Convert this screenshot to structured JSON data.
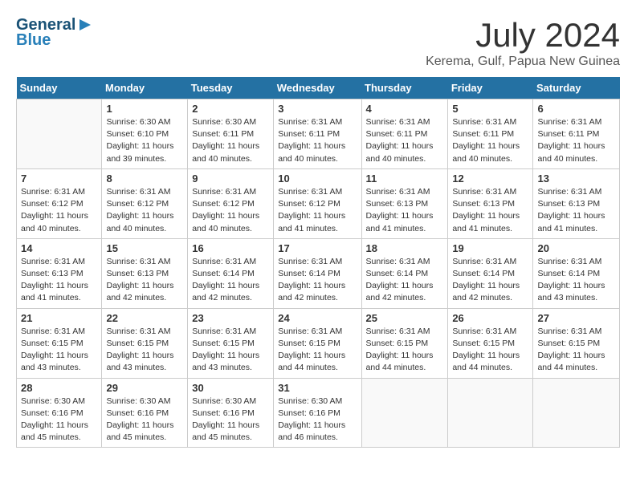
{
  "header": {
    "logo_general": "General",
    "logo_blue": "Blue",
    "title": "July 2024",
    "location": "Kerema, Gulf, Papua New Guinea"
  },
  "days_of_week": [
    "Sunday",
    "Monday",
    "Tuesday",
    "Wednesday",
    "Thursday",
    "Friday",
    "Saturday"
  ],
  "weeks": [
    [
      {
        "day": "",
        "info": ""
      },
      {
        "day": "1",
        "info": "Sunrise: 6:30 AM\nSunset: 6:10 PM\nDaylight: 11 hours\nand 39 minutes."
      },
      {
        "day": "2",
        "info": "Sunrise: 6:30 AM\nSunset: 6:11 PM\nDaylight: 11 hours\nand 40 minutes."
      },
      {
        "day": "3",
        "info": "Sunrise: 6:31 AM\nSunset: 6:11 PM\nDaylight: 11 hours\nand 40 minutes."
      },
      {
        "day": "4",
        "info": "Sunrise: 6:31 AM\nSunset: 6:11 PM\nDaylight: 11 hours\nand 40 minutes."
      },
      {
        "day": "5",
        "info": "Sunrise: 6:31 AM\nSunset: 6:11 PM\nDaylight: 11 hours\nand 40 minutes."
      },
      {
        "day": "6",
        "info": "Sunrise: 6:31 AM\nSunset: 6:11 PM\nDaylight: 11 hours\nand 40 minutes."
      }
    ],
    [
      {
        "day": "7",
        "info": "Sunrise: 6:31 AM\nSunset: 6:12 PM\nDaylight: 11 hours\nand 40 minutes."
      },
      {
        "day": "8",
        "info": "Sunrise: 6:31 AM\nSunset: 6:12 PM\nDaylight: 11 hours\nand 40 minutes."
      },
      {
        "day": "9",
        "info": "Sunrise: 6:31 AM\nSunset: 6:12 PM\nDaylight: 11 hours\nand 40 minutes."
      },
      {
        "day": "10",
        "info": "Sunrise: 6:31 AM\nSunset: 6:12 PM\nDaylight: 11 hours\nand 41 minutes."
      },
      {
        "day": "11",
        "info": "Sunrise: 6:31 AM\nSunset: 6:13 PM\nDaylight: 11 hours\nand 41 minutes."
      },
      {
        "day": "12",
        "info": "Sunrise: 6:31 AM\nSunset: 6:13 PM\nDaylight: 11 hours\nand 41 minutes."
      },
      {
        "day": "13",
        "info": "Sunrise: 6:31 AM\nSunset: 6:13 PM\nDaylight: 11 hours\nand 41 minutes."
      }
    ],
    [
      {
        "day": "14",
        "info": "Sunrise: 6:31 AM\nSunset: 6:13 PM\nDaylight: 11 hours\nand 41 minutes."
      },
      {
        "day": "15",
        "info": "Sunrise: 6:31 AM\nSunset: 6:13 PM\nDaylight: 11 hours\nand 42 minutes."
      },
      {
        "day": "16",
        "info": "Sunrise: 6:31 AM\nSunset: 6:14 PM\nDaylight: 11 hours\nand 42 minutes."
      },
      {
        "day": "17",
        "info": "Sunrise: 6:31 AM\nSunset: 6:14 PM\nDaylight: 11 hours\nand 42 minutes."
      },
      {
        "day": "18",
        "info": "Sunrise: 6:31 AM\nSunset: 6:14 PM\nDaylight: 11 hours\nand 42 minutes."
      },
      {
        "day": "19",
        "info": "Sunrise: 6:31 AM\nSunset: 6:14 PM\nDaylight: 11 hours\nand 42 minutes."
      },
      {
        "day": "20",
        "info": "Sunrise: 6:31 AM\nSunset: 6:14 PM\nDaylight: 11 hours\nand 43 minutes."
      }
    ],
    [
      {
        "day": "21",
        "info": "Sunrise: 6:31 AM\nSunset: 6:15 PM\nDaylight: 11 hours\nand 43 minutes."
      },
      {
        "day": "22",
        "info": "Sunrise: 6:31 AM\nSunset: 6:15 PM\nDaylight: 11 hours\nand 43 minutes."
      },
      {
        "day": "23",
        "info": "Sunrise: 6:31 AM\nSunset: 6:15 PM\nDaylight: 11 hours\nand 43 minutes."
      },
      {
        "day": "24",
        "info": "Sunrise: 6:31 AM\nSunset: 6:15 PM\nDaylight: 11 hours\nand 44 minutes."
      },
      {
        "day": "25",
        "info": "Sunrise: 6:31 AM\nSunset: 6:15 PM\nDaylight: 11 hours\nand 44 minutes."
      },
      {
        "day": "26",
        "info": "Sunrise: 6:31 AM\nSunset: 6:15 PM\nDaylight: 11 hours\nand 44 minutes."
      },
      {
        "day": "27",
        "info": "Sunrise: 6:31 AM\nSunset: 6:15 PM\nDaylight: 11 hours\nand 44 minutes."
      }
    ],
    [
      {
        "day": "28",
        "info": "Sunrise: 6:30 AM\nSunset: 6:16 PM\nDaylight: 11 hours\nand 45 minutes."
      },
      {
        "day": "29",
        "info": "Sunrise: 6:30 AM\nSunset: 6:16 PM\nDaylight: 11 hours\nand 45 minutes."
      },
      {
        "day": "30",
        "info": "Sunrise: 6:30 AM\nSunset: 6:16 PM\nDaylight: 11 hours\nand 45 minutes."
      },
      {
        "day": "31",
        "info": "Sunrise: 6:30 AM\nSunset: 6:16 PM\nDaylight: 11 hours\nand 46 minutes."
      },
      {
        "day": "",
        "info": ""
      },
      {
        "day": "",
        "info": ""
      },
      {
        "day": "",
        "info": ""
      }
    ]
  ]
}
